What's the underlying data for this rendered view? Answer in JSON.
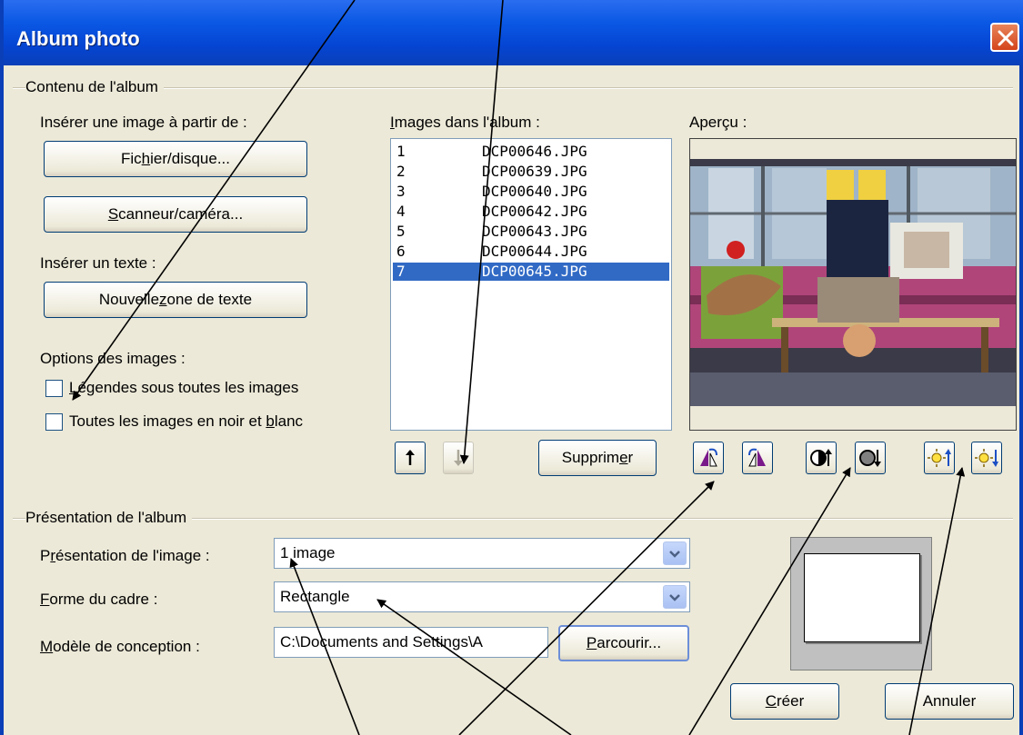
{
  "window": {
    "title": "Album photo"
  },
  "content_group": {
    "label": "Contenu de l'album",
    "insert_image_label": "Insérer une image à partir de :",
    "file_button": {
      "pre": "Fic",
      "u": "h",
      "post": "ier/disque..."
    },
    "scanner_button": {
      "pre": "",
      "u": "S",
      "post": "canneur/caméra..."
    },
    "insert_text_label": "Insérer un texte :",
    "new_textbox_button": {
      "pre": "Nouvelle ",
      "u": "z",
      "post": "one de texte"
    },
    "image_options_label": "Options des images :",
    "captions_checkbox": {
      "pre": "",
      "u": "L",
      "post": "égendes sous toutes les images",
      "checked": false
    },
    "bw_checkbox": {
      "pre": "Toutes les images en noir et ",
      "u": "b",
      "post": "lanc",
      "checked": false
    },
    "images_list_label": {
      "pre": "",
      "u": "I",
      "post": "mages dans l'album :"
    },
    "images": [
      {
        "num": "1",
        "name": "DCP00646.JPG"
      },
      {
        "num": "2",
        "name": "DCP00639.JPG"
      },
      {
        "num": "3",
        "name": "DCP00640.JPG"
      },
      {
        "num": "4",
        "name": "DCP00642.JPG"
      },
      {
        "num": "5",
        "name": "DCP00643.JPG"
      },
      {
        "num": "6",
        "name": "DCP00644.JPG"
      },
      {
        "num": "7",
        "name": "DCP00645.JPG"
      }
    ],
    "selected_image": "7",
    "delete_button": {
      "pre": "Supprim",
      "u": "e",
      "post": "r"
    },
    "preview_label": "Aperçu :",
    "move_up_icon": "arrow-up-icon",
    "move_down_icon": "arrow-down-icon",
    "rotate_left_icon": "rotate-left-icon",
    "rotate_right_icon": "rotate-right-icon",
    "contrast_up_icon": "contrast-up-icon",
    "contrast_down_icon": "contrast-down-icon",
    "brightness_up_icon": "brightness-up-icon",
    "brightness_down_icon": "brightness-down-icon"
  },
  "layout_group": {
    "label": "Présentation de l'album",
    "picture_layout_label": {
      "pre": "P",
      "u": "r",
      "post": "ésentation de l'image :"
    },
    "picture_layout_value": "1 image",
    "frame_shape_label": {
      "pre": "",
      "u": "F",
      "post": "orme du cadre :"
    },
    "frame_shape_value": "Rectangle",
    "design_template_label": {
      "pre": "",
      "u": "M",
      "post": "odèle de conception :"
    },
    "design_template_value": "C:\\Documents and Settings\\A",
    "browse_button": {
      "pre": "",
      "u": "P",
      "post": "arcourir..."
    }
  },
  "footer": {
    "create_button": {
      "pre": "",
      "u": "C",
      "post": "réer"
    },
    "cancel_button": "Annuler"
  },
  "colors": {
    "title_bar": "#0a58e4",
    "dialog_bg": "#ece9d8",
    "selection": "#316ac5",
    "close_button": "#d4431b"
  }
}
